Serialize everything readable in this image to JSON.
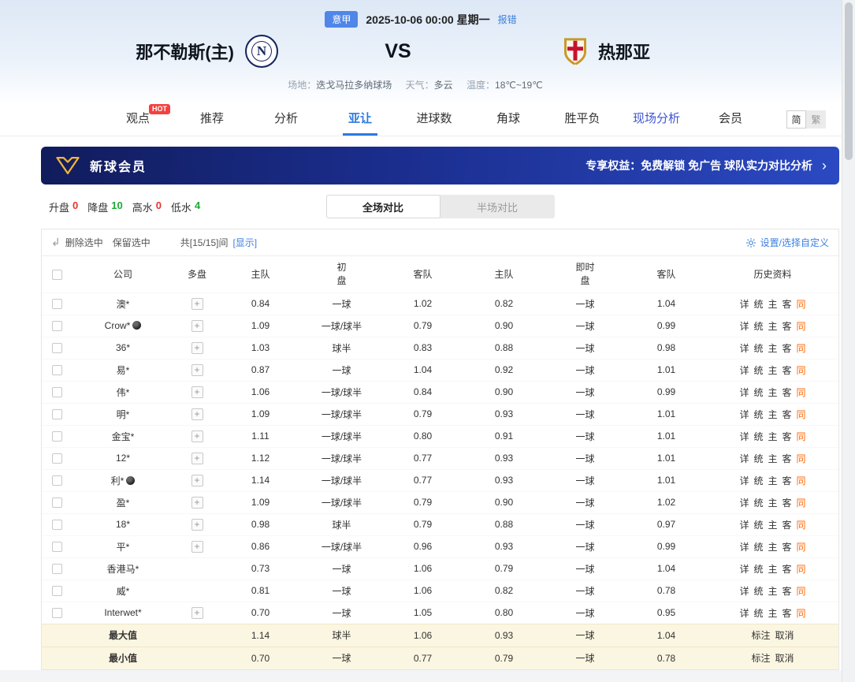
{
  "page": {
    "lang_simplified": "简",
    "lang_traditional": "繁"
  },
  "match_header": {
    "league": "意甲",
    "datetime": "2025-10-06 00:00 星期一",
    "report_error": "报错",
    "home_team": "那不勒斯(主)",
    "home_logo_letter": "N",
    "vs": "VS",
    "away_team": "热那亚",
    "venue_label": "场地：",
    "venue": "迭戈马拉多纳球场",
    "weather_label": "天气：",
    "weather": "多云",
    "temperature_label": "温度：",
    "temperature": "18℃~19℃"
  },
  "nav": {
    "items": [
      {
        "label": "观点",
        "badge": "HOT"
      },
      {
        "label": "推荐"
      },
      {
        "label": "分析"
      },
      {
        "label": "亚让",
        "active": true
      },
      {
        "label": "进球数"
      },
      {
        "label": "角球"
      },
      {
        "label": "胜平负"
      },
      {
        "label": "现场分析",
        "highlight": true
      },
      {
        "label": "会员"
      }
    ]
  },
  "member_banner": {
    "title": "新球会员",
    "benefit_text": "专享权益：免费解锁 免广告 球队实力对比分析",
    "arrow": "›"
  },
  "filter_bar": {
    "stats": [
      {
        "label": "升盘",
        "value": "0",
        "color": "#e5342c"
      },
      {
        "label": "降盘",
        "value": "10",
        "color": "#1faa38"
      },
      {
        "label": "高水",
        "value": "0",
        "color": "#e5342c"
      },
      {
        "label": "低水",
        "value": "4",
        "color": "#1faa38"
      }
    ],
    "tabs": [
      {
        "label": "全场对比"
      },
      {
        "label": "半场对比"
      }
    ]
  },
  "toolbar": {
    "clear_icon": "↲",
    "delete_selected": "删除选中",
    "keep_selected": "保留选中",
    "count": "共[15/15]间",
    "show": "[显示]",
    "customize": "设置/选择自定义"
  },
  "odds_table": {
    "col_company": "公司",
    "col_multi": "多盘",
    "col_home": "主队",
    "col_away": "客队",
    "group_initial": "初",
    "group_live": "即时",
    "col_line": "盘",
    "col_history": "历史资料",
    "multi_icon": "+",
    "history_links": [
      "详",
      "统",
      "主",
      "客",
      "同"
    ],
    "summary_links": [
      "标注",
      "取消"
    ],
    "rows": [
      {
        "company": "澳*",
        "ball": false,
        "multi": true,
        "init": [
          "0.84",
          "一球",
          "1.02"
        ],
        "live": [
          "0.82",
          "一球",
          "1.04"
        ]
      },
      {
        "company": "Crow*",
        "ball": true,
        "multi": true,
        "init": [
          "1.09",
          "一球/球半",
          "0.79"
        ],
        "live": [
          "0.90",
          "一球",
          "0.99"
        ]
      },
      {
        "company": "36*",
        "ball": false,
        "multi": true,
        "init": [
          "1.03",
          "球半",
          "0.83"
        ],
        "live": [
          "0.88",
          "一球",
          "0.98"
        ]
      },
      {
        "company": "易*",
        "ball": false,
        "multi": true,
        "init": [
          "0.87",
          "一球",
          "1.04"
        ],
        "live": [
          "0.92",
          "一球",
          "1.01"
        ]
      },
      {
        "company": "伟*",
        "ball": false,
        "multi": true,
        "init": [
          "1.06",
          "一球/球半",
          "0.84"
        ],
        "live": [
          "0.90",
          "一球",
          "0.99"
        ]
      },
      {
        "company": "明*",
        "ball": false,
        "multi": true,
        "init": [
          "1.09",
          "一球/球半",
          "0.79"
        ],
        "live": [
          "0.93",
          "一球",
          "1.01"
        ]
      },
      {
        "company": "金宝*",
        "ball": false,
        "multi": true,
        "init": [
          "1.11",
          "一球/球半",
          "0.80"
        ],
        "live": [
          "0.91",
          "一球",
          "1.01"
        ]
      },
      {
        "company": "12*",
        "ball": false,
        "multi": true,
        "init": [
          "1.12",
          "一球/球半",
          "0.77"
        ],
        "live": [
          "0.93",
          "一球",
          "1.01"
        ]
      },
      {
        "company": "利*",
        "ball": true,
        "multi": true,
        "init": [
          "1.14",
          "一球/球半",
          "0.77"
        ],
        "live": [
          "0.93",
          "一球",
          "1.01"
        ]
      },
      {
        "company": "盈*",
        "ball": false,
        "multi": true,
        "init": [
          "1.09",
          "一球/球半",
          "0.79"
        ],
        "live": [
          "0.90",
          "一球",
          "1.02"
        ]
      },
      {
        "company": "18*",
        "ball": false,
        "multi": true,
        "init": [
          "0.98",
          "球半",
          "0.79"
        ],
        "live": [
          "0.88",
          "一球",
          "0.97"
        ]
      },
      {
        "company": "平*",
        "ball": false,
        "multi": true,
        "init": [
          "0.86",
          "一球/球半",
          "0.96"
        ],
        "live": [
          "0.93",
          "一球",
          "0.99"
        ]
      },
      {
        "company": "香港马*",
        "ball": false,
        "multi": false,
        "init": [
          "0.73",
          "一球",
          "1.06"
        ],
        "live": [
          "0.79",
          "一球",
          "1.04"
        ]
      },
      {
        "company": "威*",
        "ball": false,
        "multi": false,
        "init": [
          "0.81",
          "一球",
          "1.06"
        ],
        "live": [
          "0.82",
          "一球",
          "0.78"
        ]
      },
      {
        "company": "Interwet*",
        "ball": false,
        "multi": true,
        "init": [
          "0.70",
          "一球",
          "1.05"
        ],
        "live": [
          "0.80",
          "一球",
          "0.95"
        ]
      }
    ],
    "summary": [
      {
        "label": "最大值",
        "init": [
          "1.14",
          "球半",
          "1.06"
        ],
        "live": [
          "0.93",
          "一球",
          "1.04"
        ]
      },
      {
        "label": "最小值",
        "init": [
          "0.70",
          "一球",
          "0.77"
        ],
        "live": [
          "0.79",
          "一球",
          "0.78"
        ]
      }
    ]
  }
}
